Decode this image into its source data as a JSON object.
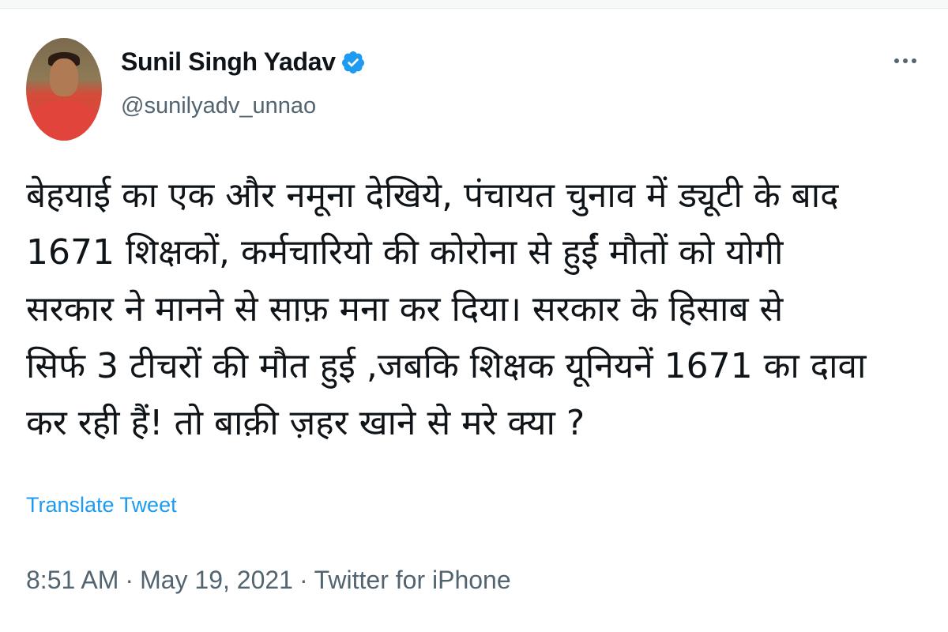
{
  "tweet": {
    "author": {
      "display_name": "Sunil Singh Yadav",
      "handle": "@sunilyadv_unnao",
      "verified": true
    },
    "text_lines": [
      "बेहयाई का एक और नमूना देखिये, पंचायत चुनाव में ड्यूटी के बाद",
      "1671 शिक्षकों, कर्मचारियो की कोरोना से हुईं मौतों को योगी",
      "सरकार ने मानने से साफ़ मना कर दिया। सरकार के हिसाब से",
      "सिर्फ 3 टीचरों की मौत हुई ,जबकि शिक्षक यूनियनें 1671 का दावा",
      "कर रही हैं! तो बाक़ी ज़हर खाने से मरे क्या ?"
    ],
    "translate_label": "Translate Tweet",
    "time": "8:51 AM",
    "separator": "·",
    "date": "May 19, 2021",
    "source": "Twitter for iPhone"
  },
  "icons": {
    "verified": "verified-badge-icon",
    "more": "more-options-icon"
  },
  "colors": {
    "text_primary": "#0f1419",
    "text_secondary": "#536471",
    "accent": "#1d9bf0"
  }
}
